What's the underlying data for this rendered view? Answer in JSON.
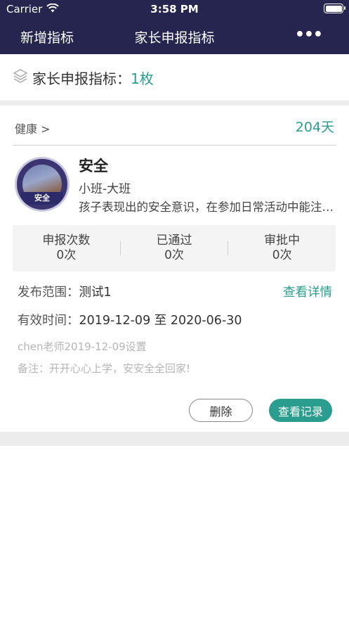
{
  "status_bar": {
    "carrier": "Carrier",
    "time": "3:58 PM"
  },
  "nav": {
    "left_button": "新增指标",
    "title": "家长申报指标",
    "more": "•••"
  },
  "summary": {
    "label": "家长申报指标：",
    "count": "1枚"
  },
  "card": {
    "category": "健康 >",
    "days": "204天",
    "avatar_badge": "安全",
    "title": "安全",
    "class_range": "小班-大班",
    "description": "孩子表现出的安全意识，在参加日常活动中能注意安全，有自我保护意识",
    "stats": [
      {
        "label": "申报次数",
        "value": "0次"
      },
      {
        "label": "已通过",
        "value": "0次"
      },
      {
        "label": "审批中",
        "value": "0次"
      }
    ],
    "scope_label": "发布范围：",
    "scope_value": "测试1",
    "detail_link": "查看详情",
    "valid_label": "有效时间：",
    "valid_value": "2019-12-09 至 2020-06-30",
    "setter": "chen老师2019-12-09设置",
    "remark": "备注：开开心心上学，安安全全回家!",
    "delete_button": "删除",
    "record_button": "查看记录"
  },
  "colors": {
    "nav_bg": "#252550",
    "accent": "#2a9d8f"
  },
  "icons": {
    "wifi": "wifi-icon",
    "battery": "battery-icon",
    "layers": "layers-icon",
    "more": "more-icon"
  }
}
